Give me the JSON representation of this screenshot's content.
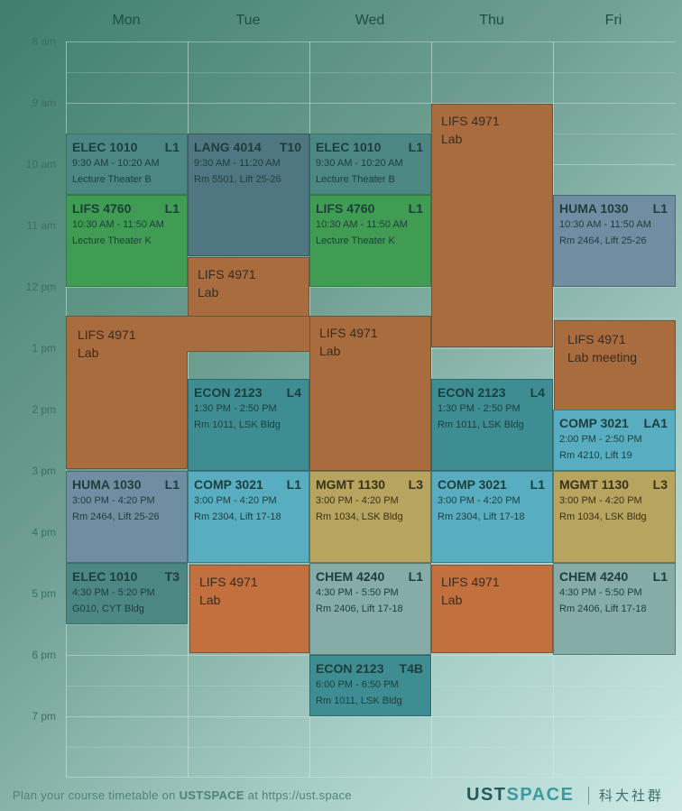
{
  "days": [
    "Mon",
    "Tue",
    "Wed",
    "Thu",
    "Fri"
  ],
  "times": [
    "8 am",
    "9 am",
    "10 am",
    "11 am",
    "12 pm",
    "1 pm",
    "2 pm",
    "3 pm",
    "4 pm",
    "5 pm",
    "6 pm",
    "7 pm"
  ],
  "events": [
    {
      "code": "ELEC 1010",
      "sec": "L1",
      "time": "9:30 AM - 10:20 AM",
      "loc": "Lecture Theater B"
    },
    {
      "code": "LANG 4014",
      "sec": "T10",
      "time": "9:30 AM - 11:20 AM",
      "loc": "Rm 5501, Lift 25-26"
    },
    {
      "code": "ELEC 1010",
      "sec": "L1",
      "time": "9:30 AM - 10:20 AM",
      "loc": "Lecture Theater B"
    },
    {
      "code": "LIFS 4760",
      "sec": "L1",
      "time": "10:30 AM - 11:50 AM",
      "loc": "Lecture Theater K"
    },
    {
      "code": "LIFS 4760",
      "sec": "L1",
      "time": "10:30 AM - 11:50 AM",
      "loc": "Lecture Theater K"
    },
    {
      "code": "HUMA 1030",
      "sec": "L1",
      "time": "10:30 AM - 11:50 AM",
      "loc": "Rm 2464, Lift 25-26"
    },
    {
      "code": "ECON 2123",
      "sec": "L4",
      "time": "1:30 PM - 2:50 PM",
      "loc": "Rm 1011, LSK Bldg"
    },
    {
      "code": "ECON 2123",
      "sec": "L4",
      "time": "1:30 PM - 2:50 PM",
      "loc": "Rm 1011, LSK Bldg"
    },
    {
      "code": "COMP 3021",
      "sec": "LA1",
      "time": "2:00 PM - 2:50 PM",
      "loc": "Rm 4210, Lift 19"
    },
    {
      "code": "HUMA 1030",
      "sec": "L1",
      "time": "3:00 PM - 4:20 PM",
      "loc": "Rm 2464, Lift 25-26"
    },
    {
      "code": "COMP 3021",
      "sec": "L1",
      "time": "3:00 PM - 4:20 PM",
      "loc": "Rm 2304, Lift 17-18"
    },
    {
      "code": "MGMT 1130",
      "sec": "L3",
      "time": "3:00 PM - 4:20 PM",
      "loc": "Rm 1034, LSK Bldg"
    },
    {
      "code": "COMP 3021",
      "sec": "L1",
      "time": "3:00 PM - 4:20 PM",
      "loc": "Rm 2304, Lift 17-18"
    },
    {
      "code": "MGMT 1130",
      "sec": "L3",
      "time": "3:00 PM - 4:20 PM",
      "loc": "Rm 1034, LSK Bldg"
    },
    {
      "code": "ELEC 1010",
      "sec": "T3",
      "time": "4:30 PM - 5:20 PM",
      "loc": "G010, CYT Bldg"
    },
    {
      "code": "CHEM 4240",
      "sec": "L1",
      "time": "4:30 PM - 5:50 PM",
      "loc": "Rm 2406, Lift 17-18"
    },
    {
      "code": "CHEM 4240",
      "sec": "L1",
      "time": "4:30 PM - 5:50 PM",
      "loc": "Rm 2406, Lift 17-18"
    },
    {
      "code": "ECON 2123",
      "sec": "T4B",
      "time": "6:00 PM - 6:50 PM",
      "loc": "Rm 1011, LSK Bldg"
    }
  ],
  "custom": [
    {
      "title": "LIFS 4971",
      "sub": "Lab"
    },
    {
      "title": "LIFS 4971",
      "sub": "Lab"
    },
    {
      "title": "LIFS 4971",
      "sub": "Lab"
    },
    {
      "title": "LIFS 4971",
      "sub": "Lab"
    },
    {
      "title": "LIFS 4971",
      "sub": "Lab meeting"
    },
    {
      "title": "LIFS 4971",
      "sub": "Lab"
    },
    {
      "title": "LIFS 4971",
      "sub": "Lab"
    }
  ],
  "footer": {
    "prefix": "Plan your course timetable on ",
    "brand": "USTSPACE",
    "suffix": " at https://ust.space"
  },
  "brand": {
    "ust": "UST",
    "space": "SPACE",
    "cn": "科大社群"
  },
  "colors": {
    "lifs": "#3f9c52",
    "elec": "#4c8784",
    "comp": "#58aec0",
    "mgmt": "#b6a45f",
    "lab": "#a96c3e",
    "brand": "#23595a"
  }
}
